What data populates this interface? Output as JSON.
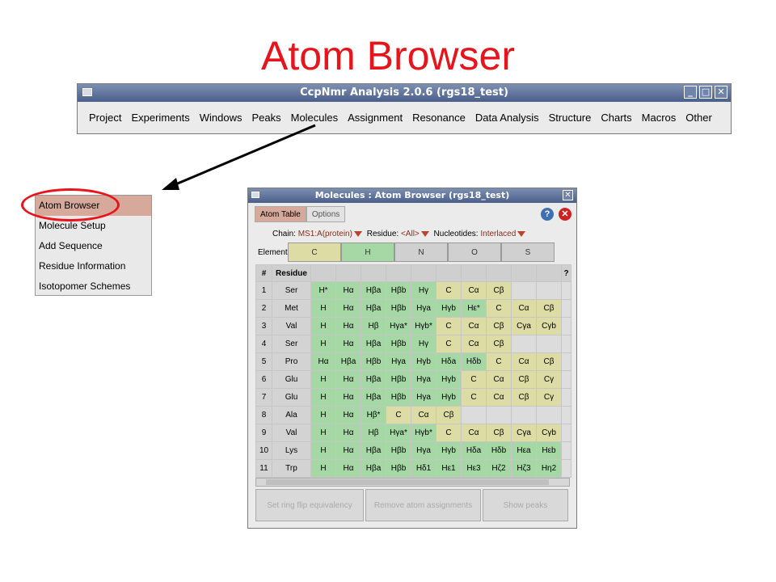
{
  "slide": {
    "title": "Atom Browser"
  },
  "main_window": {
    "title": "CcpNmr Analysis 2.0.6 (rgs18_test)",
    "menu": [
      "Project",
      "Experiments",
      "Windows",
      "Peaks",
      "Molecules",
      "Assignment",
      "Resonance",
      "Data Analysis",
      "Structure",
      "Charts",
      "Macros",
      "Other"
    ]
  },
  "molecules_menu": {
    "items": [
      "Atom Browser",
      "Molecule Setup",
      "Add Sequence",
      "Residue Information",
      "Isotopomer Schemes"
    ]
  },
  "dialog": {
    "title": "Molecules : Atom Browser (rgs18_test)",
    "tabs": [
      "Atom Table",
      "Options"
    ],
    "filters": {
      "chain_label": "Chain:",
      "chain_value": "MS1:A(protein)",
      "residue_label": "Residue:",
      "residue_value": "<All>",
      "nucleotides_label": "Nucleotides:",
      "nucleotides_value": "Interlaced"
    },
    "elements_label": "Elements:",
    "elements": [
      "C",
      "H",
      "N",
      "O",
      "S"
    ],
    "table_headers": [
      "#",
      "Residue"
    ],
    "rows": [
      {
        "num": "1",
        "res": "Ser",
        "atoms": [
          "H*",
          "Hα",
          "Hβa",
          "Hβb",
          "Hγ",
          "C",
          "Cα",
          "Cβ",
          "",
          ""
        ]
      },
      {
        "num": "2",
        "res": "Met",
        "atoms": [
          "H",
          "Hα",
          "Hβa",
          "Hβb",
          "Hγa",
          "Hγb",
          "Hε*",
          "C",
          "Cα",
          "Cβ"
        ]
      },
      {
        "num": "3",
        "res": "Val",
        "atoms": [
          "H",
          "Hα",
          "Hβ",
          "Hγa*",
          "Hγb*",
          "C",
          "Cα",
          "Cβ",
          "Cγa",
          "Cγb"
        ]
      },
      {
        "num": "4",
        "res": "Ser",
        "atoms": [
          "H",
          "Hα",
          "Hβa",
          "Hβb",
          "Hγ",
          "C",
          "Cα",
          "Cβ",
          "",
          ""
        ]
      },
      {
        "num": "5",
        "res": "Pro",
        "atoms": [
          "Hα",
          "Hβa",
          "Hβb",
          "Hγa",
          "Hγb",
          "Hδa",
          "Hδb",
          "C",
          "Cα",
          "Cβ"
        ]
      },
      {
        "num": "6",
        "res": "Glu",
        "atoms": [
          "H",
          "Hα",
          "Hβa",
          "Hβb",
          "Hγa",
          "Hγb",
          "C",
          "Cα",
          "Cβ",
          "Cγ"
        ]
      },
      {
        "num": "7",
        "res": "Glu",
        "atoms": [
          "H",
          "Hα",
          "Hβa",
          "Hβb",
          "Hγa",
          "Hγb",
          "C",
          "Cα",
          "Cβ",
          "Cγ"
        ]
      },
      {
        "num": "8",
        "res": "Ala",
        "atoms": [
          "H",
          "Hα",
          "Hβ*",
          "C",
          "Cα",
          "Cβ",
          "",
          "",
          "",
          ""
        ]
      },
      {
        "num": "9",
        "res": "Val",
        "atoms": [
          "H",
          "Hα",
          "Hβ",
          "Hγa*",
          "Hγb*",
          "C",
          "Cα",
          "Cβ",
          "Cγa",
          "Cγb"
        ]
      },
      {
        "num": "10",
        "res": "Lys",
        "atoms": [
          "H",
          "Hα",
          "Hβa",
          "Hβb",
          "Hγa",
          "Hγb",
          "Hδa",
          "Hδb",
          "Hεa",
          "Hεb"
        ]
      },
      {
        "num": "11",
        "res": "Trp",
        "atoms": [
          "H",
          "Hα",
          "Hβa",
          "Hβb",
          "Hδ1",
          "Hε1",
          "Hε3",
          "Hζ2",
          "Hζ3",
          "Hη2"
        ]
      }
    ],
    "buttons": [
      "Set ring flip equivalency",
      "Remove atom assignments",
      "Show peaks"
    ]
  },
  "colors": {
    "title_red": "#e8141b",
    "proton_cell": "#a6d8a6",
    "carbon_cell": "#dcdca4",
    "selected_tab": "#d7a99b"
  }
}
